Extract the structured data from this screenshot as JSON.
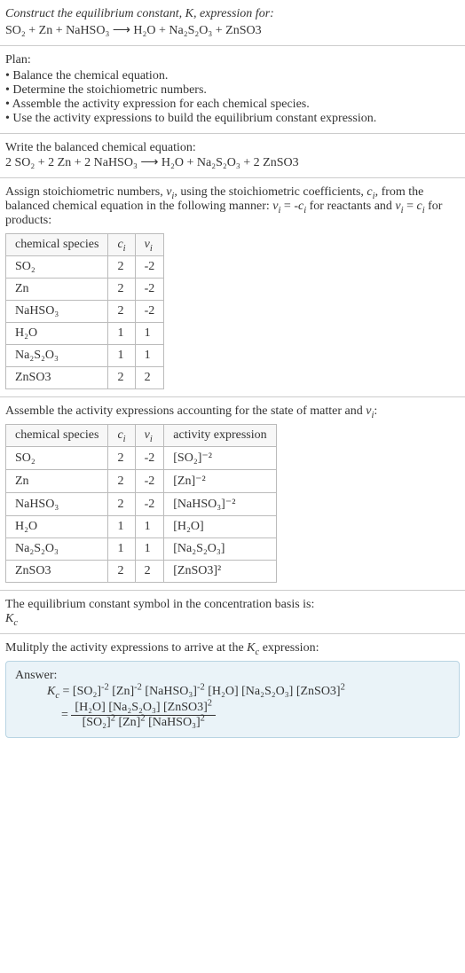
{
  "header": {
    "prompt": "Construct the equilibrium constant, K, expression for:",
    "equation": "SO₂ + Zn + NaHSO₃ ⟶ H₂O + Na₂S₂O₃ + ZnSO3"
  },
  "plan": {
    "title": "Plan:",
    "items": [
      "Balance the chemical equation.",
      "Determine the stoichiometric numbers.",
      "Assemble the activity expression for each chemical species.",
      "Use the activity expressions to build the equilibrium constant expression."
    ]
  },
  "balanced": {
    "intro": "Write the balanced chemical equation:",
    "equation": "2 SO₂ + 2 Zn + 2 NaHSO₃ ⟶ H₂O + Na₂S₂O₃ + 2 ZnSO3"
  },
  "assign": {
    "text": "Assign stoichiometric numbers, νᵢ, using the stoichiometric coefficients, cᵢ, from the balanced chemical equation in the following manner: νᵢ = -cᵢ for reactants and νᵢ = cᵢ for products:",
    "headers": [
      "chemical species",
      "cᵢ",
      "νᵢ"
    ],
    "rows": [
      [
        "SO₂",
        "2",
        "-2"
      ],
      [
        "Zn",
        "2",
        "-2"
      ],
      [
        "NaHSO₃",
        "2",
        "-2"
      ],
      [
        "H₂O",
        "1",
        "1"
      ],
      [
        "Na₂S₂O₃",
        "1",
        "1"
      ],
      [
        "ZnSO3",
        "2",
        "2"
      ]
    ]
  },
  "activity": {
    "text": "Assemble the activity expressions accounting for the state of matter and νᵢ:",
    "headers": [
      "chemical species",
      "cᵢ",
      "νᵢ",
      "activity expression"
    ],
    "rows": [
      [
        "SO₂",
        "2",
        "-2",
        "[SO₂]⁻²"
      ],
      [
        "Zn",
        "2",
        "-2",
        "[Zn]⁻²"
      ],
      [
        "NaHSO₃",
        "2",
        "-2",
        "[NaHSO₃]⁻²"
      ],
      [
        "H₂O",
        "1",
        "1",
        "[H₂O]"
      ],
      [
        "Na₂S₂O₃",
        "1",
        "1",
        "[Na₂S₂O₃]"
      ],
      [
        "ZnSO3",
        "2",
        "2",
        "[ZnSO3]²"
      ]
    ]
  },
  "symbol": {
    "text": "The equilibrium constant symbol in the concentration basis is:",
    "value": "K_c"
  },
  "multiply": {
    "text": "Mulitply the activity expressions to arrive at the K_c expression:"
  },
  "answer": {
    "label": "Answer:",
    "line1": "K_c = [SO₂]⁻² [Zn]⁻² [NaHSO₃]⁻² [H₂O] [Na₂S₂O₃] [ZnSO3]²",
    "eq": "=",
    "num": "[H₂O] [Na₂S₂O₃] [ZnSO3]²",
    "den": "[SO₂]² [Zn]² [NaHSO₃]²"
  }
}
